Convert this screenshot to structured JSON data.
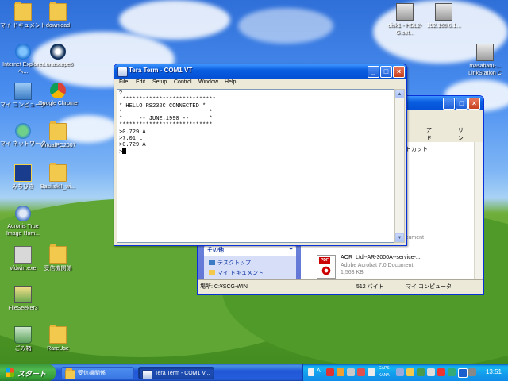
{
  "desktop": {
    "icons_left": [
      {
        "label": "マイ ドキュメント",
        "icon": "my-documents-icon"
      },
      {
        "label": "Internet Explorer へ...",
        "icon": "internet-explorer-icon"
      },
      {
        "label": "マイ コンピュータ",
        "icon": "my-computer-icon"
      },
      {
        "label": "マイ ネットワーク",
        "icon": "my-network-icon"
      },
      {
        "label": "みちびき",
        "icon": "app-icon"
      },
      {
        "label": "Acronis True Image Hom...",
        "icon": "acronis-icon"
      },
      {
        "label": "vfdwin.exe",
        "icon": "exe-icon"
      },
      {
        "label": "FileSeeker3",
        "icon": "fileseeker-icon"
      },
      {
        "label": "ごみ箱",
        "icon": "recycle-bin-icon"
      }
    ],
    "icons_col2": [
      {
        "label": "download",
        "icon": "folder-icon"
      },
      {
        "label": "Lunascape6",
        "icon": "lunascape-icon"
      },
      {
        "label": "Google Chrome",
        "icon": "chrome-icon"
      },
      {
        "label": "VirtualPC2007",
        "icon": "folder-icon"
      },
      {
        "label": "BasiliskII_wi...",
        "icon": "folder-icon"
      },
      {
        "label": "受信機関係",
        "icon": "folder-icon"
      },
      {
        "label": "RareUse",
        "icon": "folder-icon"
      }
    ],
    "icons_right": [
      {
        "label": "disk1 - HDL2-G.set...",
        "icon": "network-drive-icon"
      },
      {
        "label": "192.168.0.1...",
        "icon": "network-drive-icon"
      },
      {
        "label": "masaharu-... LinkStation C",
        "icon": "network-drive-icon"
      }
    ]
  },
  "explorer": {
    "address_label": "アドレス(D)",
    "links_label": "リンク",
    "shortcut_text": "トカット",
    "doc_text": "cument",
    "task_section_title": "その他",
    "task_items": [
      "デスクトップ",
      "マイ ドキュメント"
    ],
    "file": {
      "name": "AOR_Ltd--AR-3000A--service-...",
      "type": "Adobe Acrobat 7.0 Document",
      "size": "1,563 KB",
      "icon": "pdf-icon"
    },
    "status": {
      "location": "場所: C:¥SCG-WIN",
      "size": "512 バイト",
      "computer": "マイ コンピュータ"
    }
  },
  "teraterm": {
    "title": "Tera Term - COM1 VT",
    "menu": [
      "File",
      "Edit",
      "Setup",
      "Control",
      "Window",
      "Help"
    ],
    "terminal_lines": [
      "?",
      " ****************************",
      "* HELLO RS232C CONNECTED *",
      "*                          *",
      "*     -- JUNE.1990 --      *",
      "****************************",
      ">0.729 A",
      ">7.01 L",
      ">0.729 A",
      ">"
    ]
  },
  "taskbar": {
    "start_label": "スタート",
    "buttons": [
      {
        "label": "受信機関係",
        "icon": "folder-icon"
      },
      {
        "label": "Tera Term - COM1 V...",
        "icon": "teraterm-icon"
      }
    ],
    "clock": "13:51",
    "caps": "CAPS",
    "kana": "KANA",
    "ime_mode": "A"
  },
  "colors": {
    "titlebar": "#0a5ee0",
    "taskbar": "#245edb",
    "start_button": "#3c9a3c",
    "tray": "#139beb"
  }
}
